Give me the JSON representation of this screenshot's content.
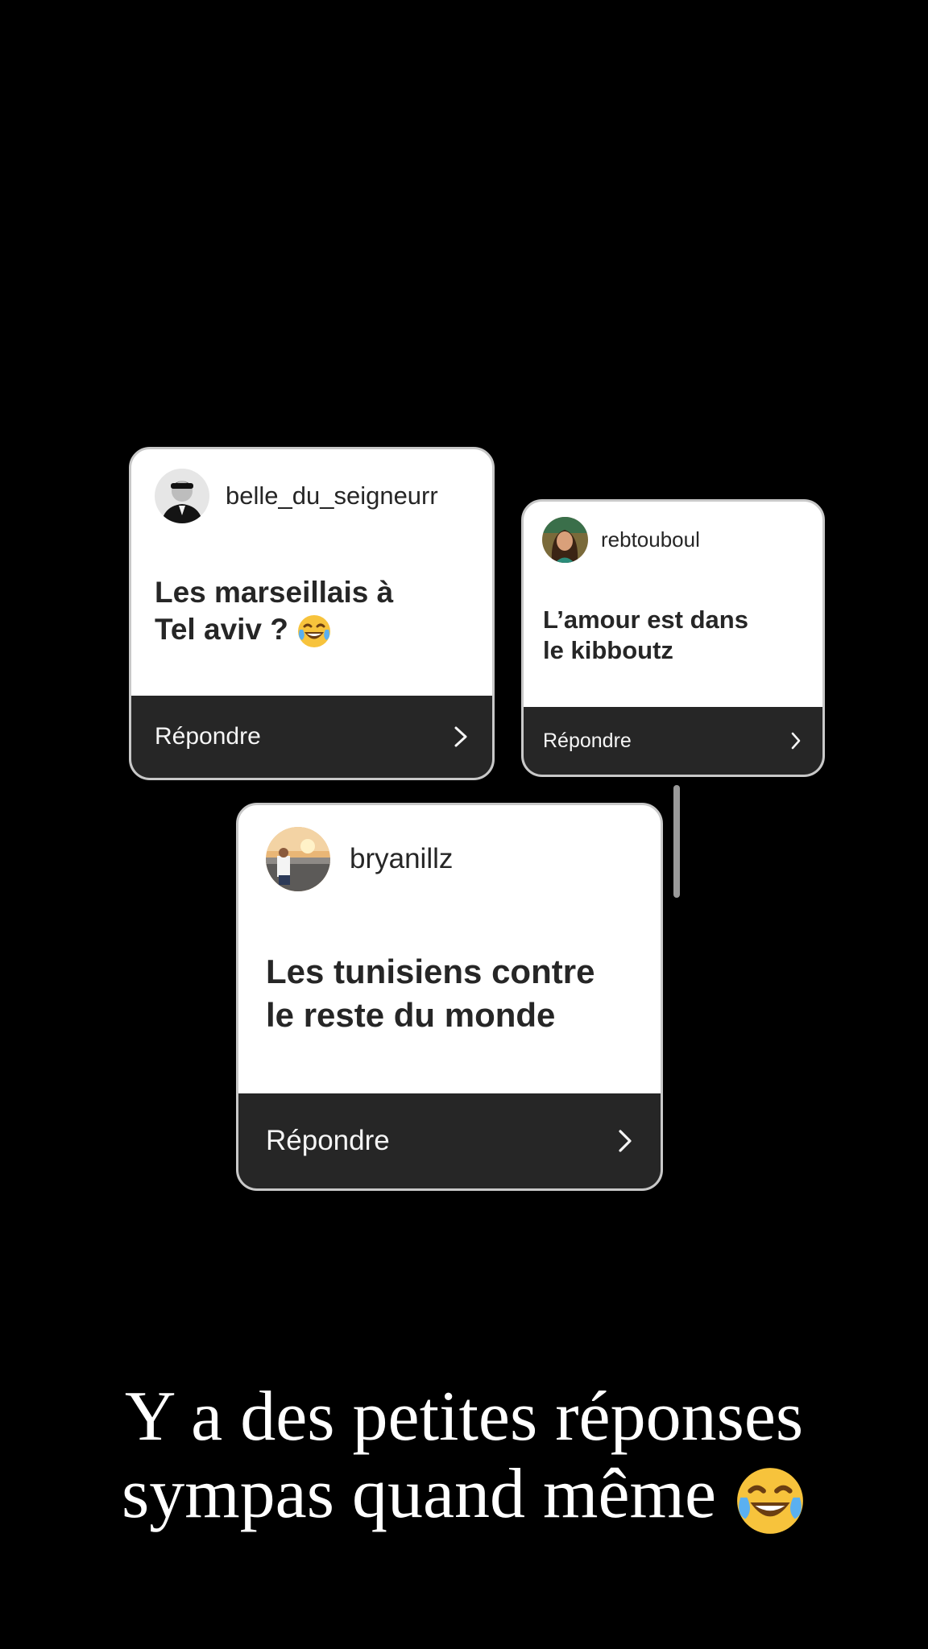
{
  "story": {
    "caption_line_1": "Y a des petites réponses",
    "caption_line_2": "sympas quand même",
    "caption_emoji": "laughing-tears-emoji"
  },
  "cards": [
    {
      "username": "belle_du_seigneurr",
      "question_line_1": "Les marseillais à",
      "question_line_2": "Tel aviv ?",
      "question_emoji": "laughing-tears-emoji",
      "reply_label": "Répondre"
    },
    {
      "username": "rebtouboul",
      "question_line_1": "L’amour est dans",
      "question_line_2": "le kibboutz",
      "reply_label": "Répondre"
    },
    {
      "username": "bryanillz",
      "question_line_1": "Les tunisiens contre",
      "question_line_2": "le reste du monde",
      "reply_label": "Répondre"
    }
  ],
  "colors": {
    "background": "#000000",
    "card_background": "#ffffff",
    "reply_bar": "#262626",
    "text_dark": "#262626",
    "text_light": "#ffffff"
  }
}
